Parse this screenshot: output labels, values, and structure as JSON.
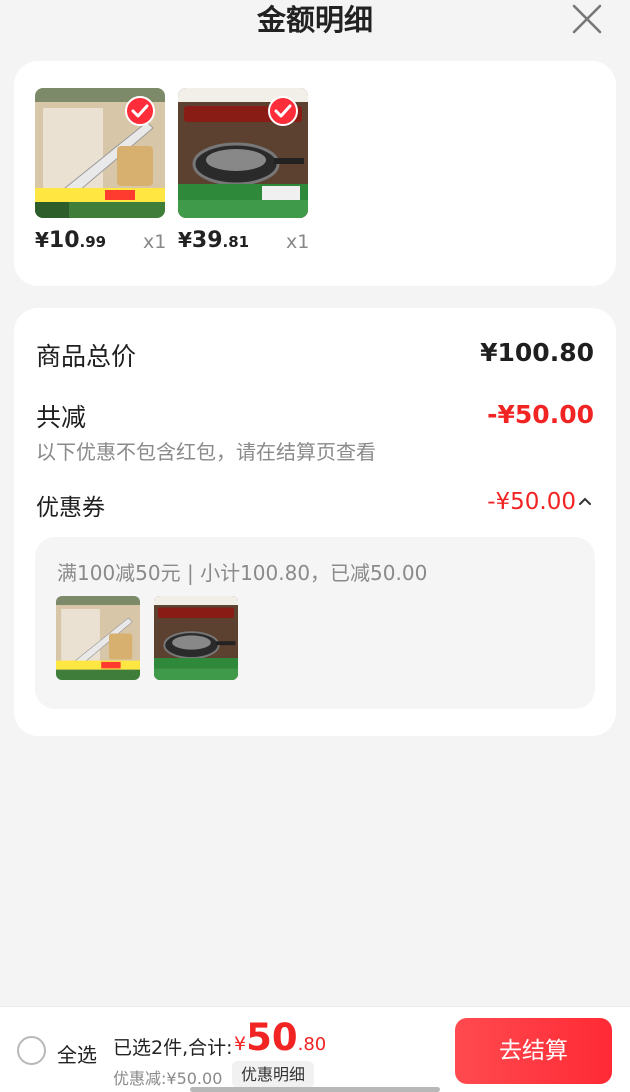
{
  "header": {
    "title": "金额明细",
    "close_icon": "close-icon"
  },
  "products": [
    {
      "price_symbol": "¥",
      "price_int": "10",
      "price_dec": ".99",
      "qty": "x1",
      "checked": true
    },
    {
      "price_symbol": "¥",
      "price_int": "39",
      "price_dec": ".81",
      "qty": "x1",
      "checked": true
    }
  ],
  "breakdown": {
    "total_label": "商品总价",
    "total_value": "¥100.80",
    "reduce_label": "共减",
    "reduce_value": "-¥50.00",
    "note": "以下优惠不包含红包，请在结算页查看",
    "coupon_label": "优惠券",
    "coupon_value": "-¥50.00",
    "coupon_desc": "满100减50元 | 小计100.80，已减50.00"
  },
  "bottom_bar": {
    "select_all": "全选",
    "selected_text": "已选2件,合计:",
    "total_symbol": "¥",
    "total_int": "50",
    "total_dec": ".80",
    "discount_text": "优惠减:¥50.00",
    "detail_button": "优惠明细",
    "checkout_button": "去结算"
  },
  "colors": {
    "accent_red": "#f22323",
    "checkout_start": "#ff4a4f",
    "checkout_end": "#ff2a35"
  }
}
